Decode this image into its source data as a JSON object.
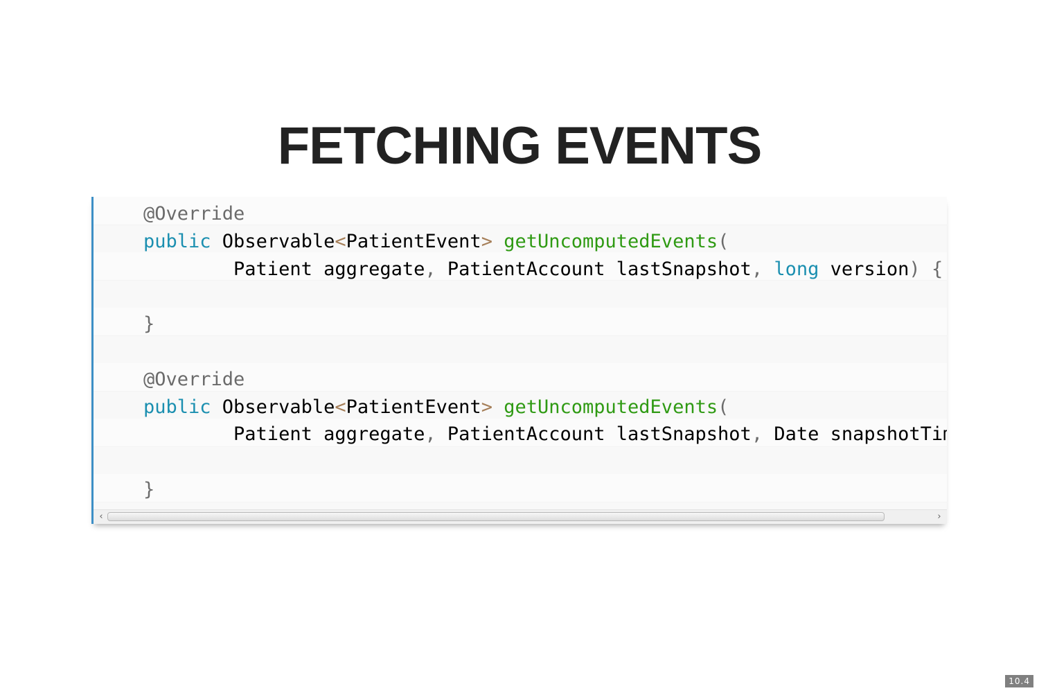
{
  "slide": {
    "title": "FETCHING EVENTS",
    "number": "10.4"
  },
  "code": {
    "language": "java",
    "lines": [
      [
        {
          "t": "annot",
          "v": "@Override"
        }
      ],
      [
        {
          "t": "kw",
          "v": "public"
        },
        {
          "t": "plain",
          "v": " Observable"
        },
        {
          "t": "op",
          "v": "<"
        },
        {
          "t": "plain",
          "v": "PatientEvent"
        },
        {
          "t": "op",
          "v": ">"
        },
        {
          "t": "plain",
          "v": " "
        },
        {
          "t": "fn",
          "v": "getUncomputedEvents"
        },
        {
          "t": "punc",
          "v": "("
        }
      ],
      [
        {
          "t": "plain",
          "v": "        Patient aggregate"
        },
        {
          "t": "punc",
          "v": ","
        },
        {
          "t": "plain",
          "v": " PatientAccount lastSnapshot"
        },
        {
          "t": "punc",
          "v": ","
        },
        {
          "t": "plain",
          "v": " "
        },
        {
          "t": "kw",
          "v": "long"
        },
        {
          "t": "plain",
          "v": " version"
        },
        {
          "t": "punc",
          "v": ")"
        },
        {
          "t": "plain",
          "v": " "
        },
        {
          "t": "punc",
          "v": "{"
        }
      ],
      [
        {
          "t": "plain",
          "v": ""
        }
      ],
      [
        {
          "t": "punc",
          "v": "}"
        }
      ],
      [
        {
          "t": "plain",
          "v": ""
        }
      ],
      [
        {
          "t": "annot",
          "v": "@Override"
        }
      ],
      [
        {
          "t": "kw",
          "v": "public"
        },
        {
          "t": "plain",
          "v": " Observable"
        },
        {
          "t": "op",
          "v": "<"
        },
        {
          "t": "plain",
          "v": "PatientEvent"
        },
        {
          "t": "op",
          "v": ">"
        },
        {
          "t": "plain",
          "v": " "
        },
        {
          "t": "fn",
          "v": "getUncomputedEvents"
        },
        {
          "t": "punc",
          "v": "("
        }
      ],
      [
        {
          "t": "plain",
          "v": "        Patient aggregate"
        },
        {
          "t": "punc",
          "v": ","
        },
        {
          "t": "plain",
          "v": " PatientAccount lastSnapshot"
        },
        {
          "t": "punc",
          "v": ","
        },
        {
          "t": "plain",
          "v": " Date snapshotTim"
        }
      ],
      [
        {
          "t": "plain",
          "v": ""
        }
      ],
      [
        {
          "t": "punc",
          "v": "}"
        }
      ]
    ]
  },
  "scrollbar": {
    "left_arrow": "‹",
    "right_arrow": "›"
  },
  "colors": {
    "accent_border": "#3d8fc6",
    "keyword": "#1b8fb0",
    "function": "#2f9a13",
    "operator": "#a67f59",
    "punctuation": "#6b6b6b"
  }
}
